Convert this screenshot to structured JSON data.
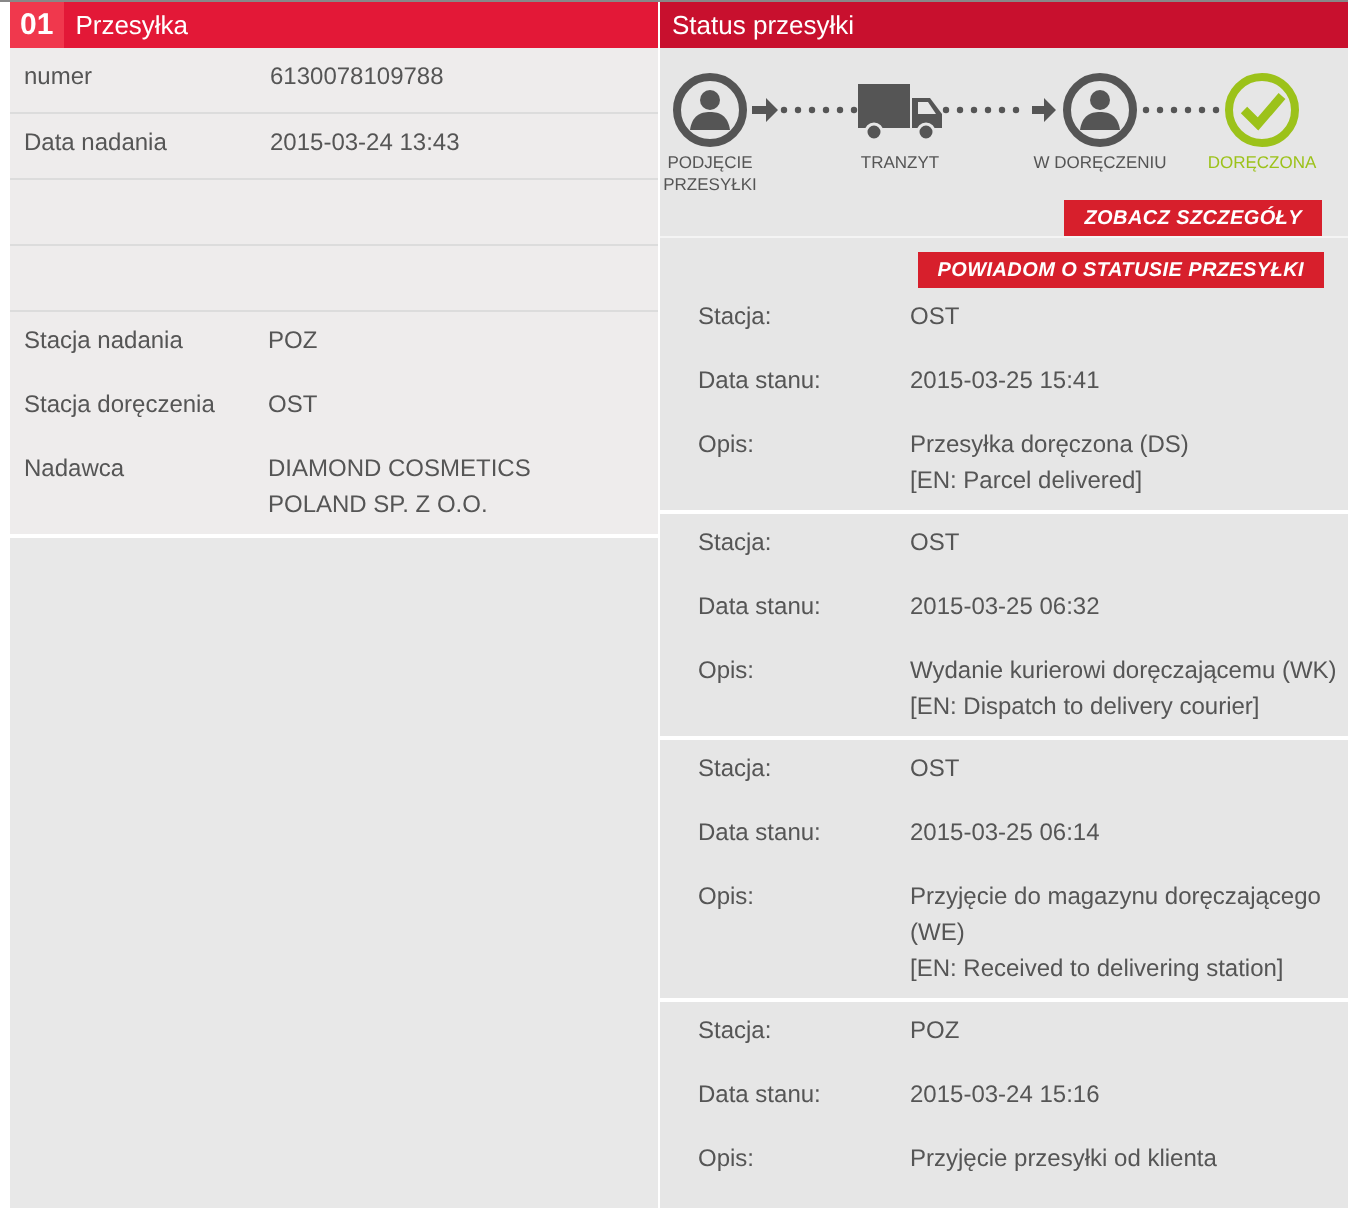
{
  "shipment": {
    "number_badge": "01",
    "title": "Przesyłka",
    "fields": [
      {
        "label": "numer",
        "value": "6130078109788"
      },
      {
        "label": "Data nadania",
        "value": "2015-03-24 13:43"
      }
    ],
    "details": [
      {
        "label": "Stacja nadania",
        "value": "POZ"
      },
      {
        "label": "Stacja doręczenia",
        "value": "OST"
      },
      {
        "label": "Nadawca",
        "value": "DIAMOND COSMETICS POLAND SP. Z O.O."
      }
    ]
  },
  "status": {
    "title": "Status przesyłki",
    "steps": [
      {
        "kind": "person",
        "label": "PODJĘCIE PRZESYŁKI",
        "current": false
      },
      {
        "kind": "truck",
        "label": "TRANZYT",
        "current": false
      },
      {
        "kind": "person",
        "label": "W DORĘCZENIU",
        "current": false
      },
      {
        "kind": "check",
        "label": "DORĘCZONA",
        "current": true
      }
    ],
    "buttons": [
      "ZOBACZ SZCZEGÓŁY",
      "POWIADOM O STATUSIE PRZESYŁKI"
    ],
    "events": [
      {
        "station_label": "Stacja:",
        "station": "OST",
        "date_label": "Data stanu:",
        "date": "2015-03-25 15:41",
        "desc_label": "Opis:",
        "desc": "Przesyłka doręczona (DS)",
        "desc_en": "[EN: Parcel delivered]"
      },
      {
        "station_label": "Stacja:",
        "station": "OST",
        "date_label": "Data stanu:",
        "date": "2015-03-25 06:32",
        "desc_label": "Opis:",
        "desc": "Wydanie kurierowi doręczającemu (WK)",
        "desc_en": "[EN: Dispatch to delivery courier]"
      },
      {
        "station_label": "Stacja:",
        "station": "OST",
        "date_label": "Data stanu:",
        "date": "2015-03-25 06:14",
        "desc_label": "Opis:",
        "desc": "Przyjęcie do magazynu doręczającego (WE)",
        "desc_en": "[EN: Received to delivering station]"
      },
      {
        "station_label": "Stacja:",
        "station": "POZ",
        "date_label": "Data stanu:",
        "date": "2015-03-24 15:16",
        "desc_label": "Opis:",
        "desc": "Przyjęcie przesyłki od klienta"
      }
    ]
  }
}
